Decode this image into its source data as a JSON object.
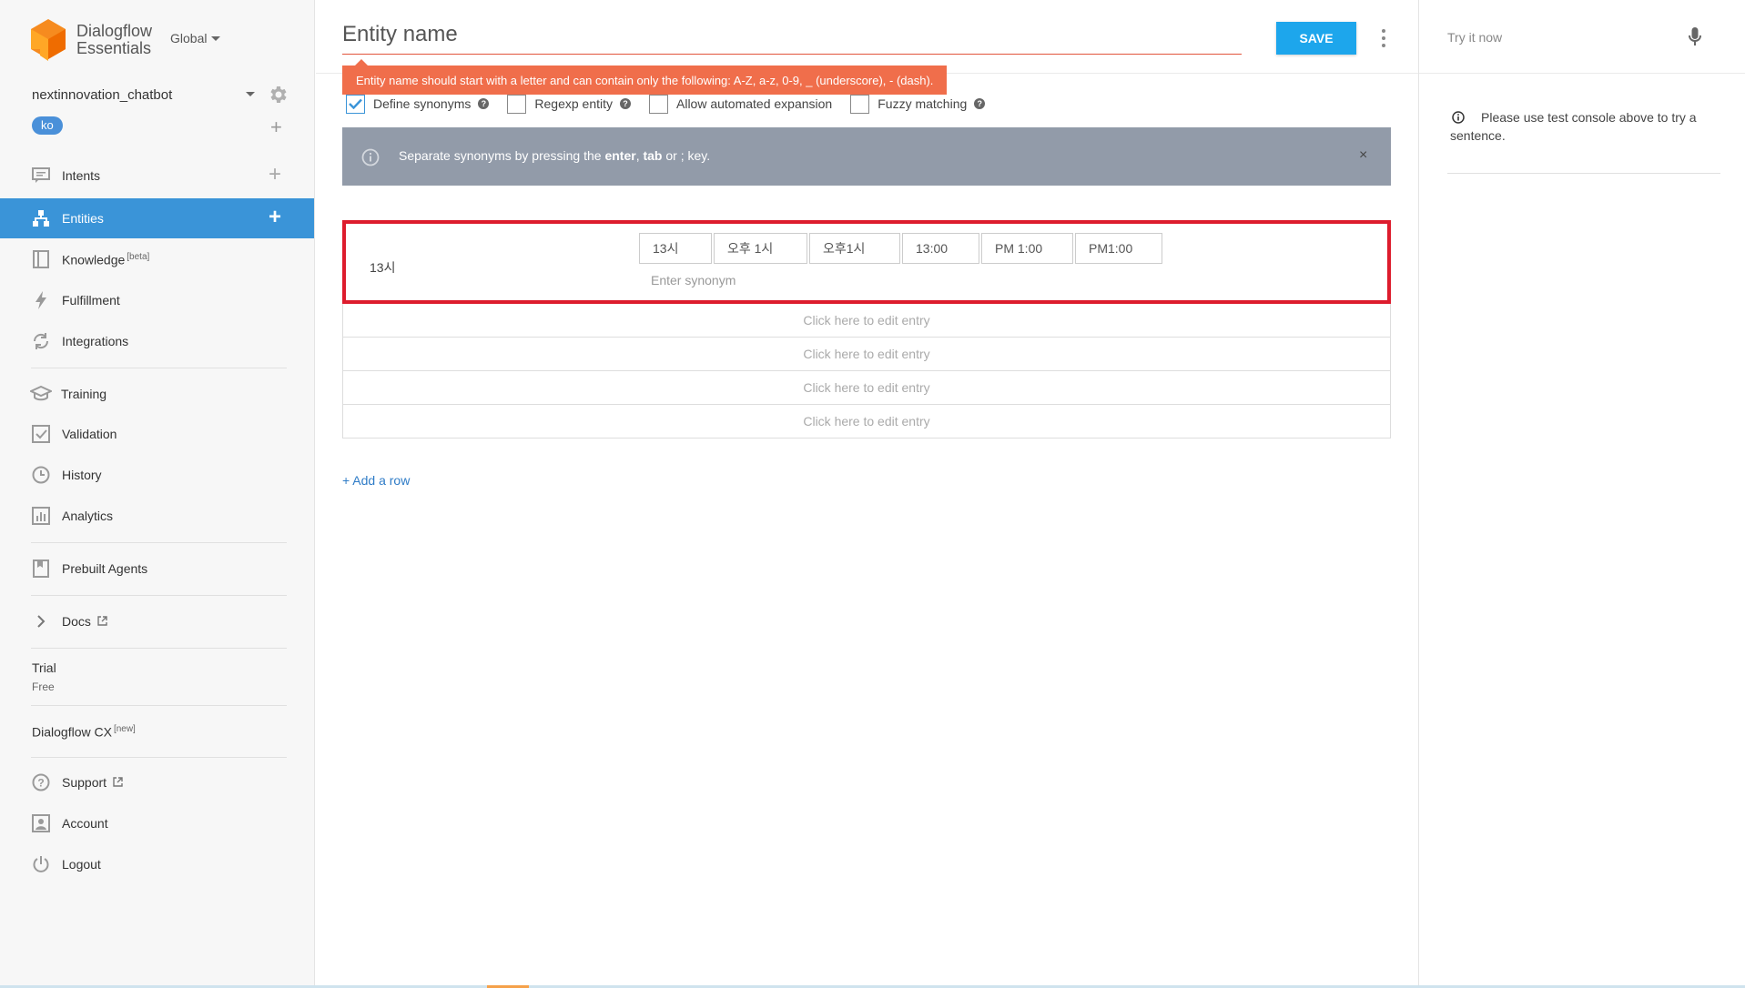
{
  "brand": {
    "line1": "Dialogflow",
    "line2": "Essentials",
    "region": "Global"
  },
  "agent": {
    "name": "nextinnovation_chatbot",
    "language": "ko"
  },
  "nav": [
    {
      "label": "Intents",
      "icon": "chat-bubble-icon"
    },
    {
      "label": "Entities",
      "icon": "sitemap-icon",
      "active": true
    },
    {
      "label": "Knowledge",
      "icon": "book-icon",
      "badge": "[beta]"
    },
    {
      "label": "Fulfillment",
      "icon": "lightning-icon"
    },
    {
      "label": "Integrations",
      "icon": "sync-icon"
    },
    {
      "label": "Training",
      "icon": "graduation-cap-icon"
    },
    {
      "label": "Validation",
      "icon": "checkbox-icon"
    },
    {
      "label": "History",
      "icon": "clock-icon"
    },
    {
      "label": "Analytics",
      "icon": "bar-chart-icon"
    },
    {
      "label": "Prebuilt Agents",
      "icon": "bookmark-icon"
    },
    {
      "label": "Docs",
      "icon": "chevron-right-icon"
    },
    {
      "label": "Support",
      "icon": "question-circle-icon"
    },
    {
      "label": "Account",
      "icon": "account-icon"
    },
    {
      "label": "Logout",
      "icon": "power-icon"
    }
  ],
  "plan": {
    "title": "Trial",
    "subtitle": "Free"
  },
  "cx": {
    "label": "Dialogflow CX",
    "badge": "[new]"
  },
  "editor": {
    "name_placeholder": "Entity name",
    "save_label": "SAVE",
    "error": "Entity name should start with a letter and can contain only the following: A-Z, a-z, 0-9, _ (underscore), - (dash).",
    "options": [
      {
        "label": "Define synonyms",
        "checked": true
      },
      {
        "label": "Regexp entity",
        "checked": false
      },
      {
        "label": "Allow automated expansion",
        "checked": false
      },
      {
        "label": "Fuzzy matching",
        "checked": false
      }
    ],
    "info": {
      "before": "Separate synonyms by pressing the ",
      "enter": "enter",
      "comma": ", ",
      "tab": "tab",
      "after": " or ; key.",
      "close": "×"
    },
    "entry": {
      "reference": "13시",
      "synonyms": [
        "13시",
        "오후 1시",
        "오후1시",
        "13:00",
        "PM 1:00",
        "PM1:00"
      ],
      "synonym_placeholder": "Enter synonym"
    },
    "empty_rows": [
      "Click here to edit entry",
      "Click here to edit entry",
      "Click here to edit entry",
      "Click here to edit entry"
    ],
    "add_row": "+ Add a row"
  },
  "console": {
    "try_placeholder": "Try it now",
    "hint": "Please use test console above to try a sentence."
  },
  "colors": {
    "accent": "#3a94d8",
    "save": "#1da6ec",
    "error": "#f06e4b",
    "highlight": "#dd1c2d",
    "info": "#929ba9"
  }
}
